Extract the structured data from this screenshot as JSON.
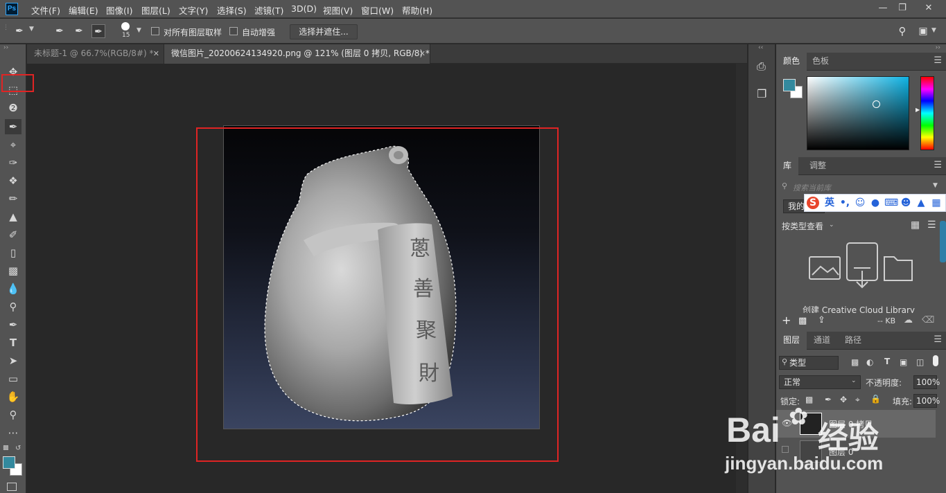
{
  "app": {
    "logo": "Ps"
  },
  "menubar": {
    "items": [
      "文件(F)",
      "编辑(E)",
      "图像(I)",
      "图层(L)",
      "文字(Y)",
      "选择(S)",
      "滤镜(T)",
      "3D(D)",
      "视图(V)",
      "窗口(W)",
      "帮助(H)"
    ],
    "window_buttons": [
      "minimize-icon",
      "restore-icon",
      "close-icon"
    ]
  },
  "options_bar": {
    "brush_size": "15",
    "sample_all_layers_label": "对所有图层取样",
    "auto_enhance_label": "自动增强",
    "select_and_mask_label": "选择并遮住..."
  },
  "tabs": [
    {
      "label": "未标题-1 @ 66.7%(RGB/8#) *",
      "active": false
    },
    {
      "label": "微信图片_20200624134920.png @ 121% (图层 0 拷贝, RGB/8) *",
      "active": true
    }
  ],
  "tools": [
    "move-tool-icon",
    "marquee-tool-icon",
    "lasso-tool-icon",
    "quick-selection-tool-icon",
    "crop-tool-icon",
    "eyedropper-tool-icon",
    "healing-brush-icon",
    "brush-tool-icon",
    "stamp-tool-icon",
    "history-brush-icon",
    "eraser-tool-icon",
    "gradient-tool-icon",
    "blur-tool-icon",
    "dodge-tool-icon",
    "pen-tool-icon",
    "type-tool-icon",
    "path-selection-icon",
    "rectangle-tool-icon",
    "hand-tool-icon",
    "zoom-tool-icon"
  ],
  "colors": {
    "foreground": "#33899e",
    "background": "#ffffff",
    "highlight": "#e02424"
  },
  "image": {
    "seal_text": [
      "蔥",
      "善",
      "聚",
      "財"
    ]
  },
  "color_panel": {
    "tab_color": "颜色",
    "tab_swatches": "色板"
  },
  "library_panel": {
    "tab_library": "库",
    "tab_adjust": "调整",
    "search_placeholder": "搜索当前库",
    "my_library": "我的库",
    "view_by_type": "按类型查看",
    "create_cc_library": "创建 Creative Cloud Library",
    "size": "-- KB"
  },
  "ime_bar": {
    "lang": "英"
  },
  "layers_panel": {
    "tab_layers": "图层",
    "tab_channels": "通道",
    "tab_paths": "路径",
    "filter_type": "类型",
    "blend_mode": "正常",
    "opacity_label": "不透明度:",
    "opacity_value": "100%",
    "lock_label": "锁定:",
    "fill_label": "填充:",
    "fill_value": "100%",
    "layers": [
      {
        "name": "图层 0 拷贝",
        "selected": true
      },
      {
        "name": "图层 0",
        "selected": false
      }
    ]
  },
  "watermark": {
    "brand": "Bai",
    "brand_cn": "经验",
    "url": "jingyan.baidu.com"
  }
}
